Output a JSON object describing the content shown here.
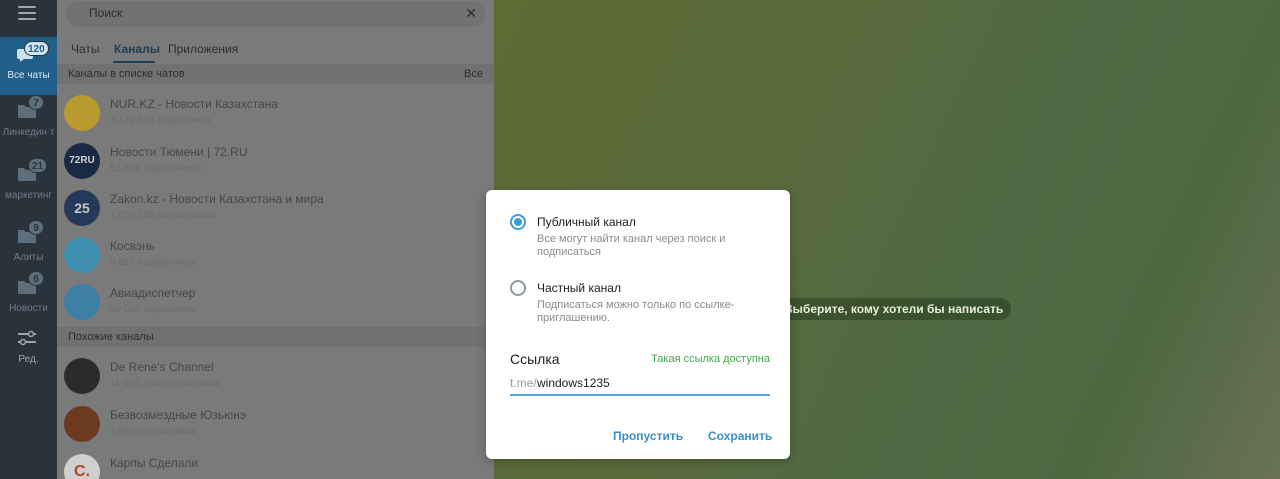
{
  "sidebar": {
    "folders": [
      {
        "label": "Все чаты",
        "badge": "120",
        "active": true
      },
      {
        "label": "Линкедин т",
        "badge": "7"
      },
      {
        "label": "маркетинг",
        "badge": "21"
      },
      {
        "label": "Алиты",
        "badge": "9"
      },
      {
        "label": "Новости",
        "badge": "6"
      },
      {
        "label": "Ред."
      }
    ]
  },
  "chatlist": {
    "search_placeholder": "Поиск",
    "tabs": [
      "Чаты",
      "Каналы",
      "Приложения"
    ],
    "section_in_list": "Каналы в списке чатов",
    "section_all": "Все",
    "channels": [
      {
        "name": "NUR.KZ - Новости Казахстана",
        "sub": "3 172 594 подписчика",
        "avatar_color": "#b89a2e",
        "avatar_text": ""
      },
      {
        "name": "Новости Тюмени | 72.RU",
        "sub": "53 536 подписчиков",
        "avatar_color": "#1b2a44",
        "avatar_text": "72RU"
      },
      {
        "name": "Zakon.kz - Новости Казахстана и мира",
        "sub": "1 036 228 подписчиков",
        "avatar_color": "#25395a",
        "avatar_text": "25"
      },
      {
        "name": "Косвэнь",
        "sub": "9 810 подписчиков",
        "avatar_color": "#3e8fb0",
        "avatar_text": ""
      },
      {
        "name": "Авиадиспетчер",
        "sub": "39 082 подписчика",
        "avatar_color": "#3e7fa6",
        "avatar_text": ""
      }
    ],
    "section_similar": "Похожие каналы",
    "similar": [
      {
        "name": "De Rene's Channel",
        "sub": "11 026 166 подписчиков",
        "avatar_color": "#2b2b2b",
        "avatar_text": ""
      },
      {
        "name": "Безвозмездные Юзьюнэ",
        "sub": "4 960 подписчиков",
        "avatar_color": "#6b3a1f",
        "avatar_text": ""
      },
      {
        "name": "Карпы Сделали",
        "sub": "",
        "avatar_color": "#eeeeee",
        "avatar_text": "C."
      }
    ]
  },
  "wallpaper": {
    "hint": "Выберите, кому хотели бы написать"
  },
  "modal": {
    "public_title": "Публичный канал",
    "public_desc": "Все могут найти канал через поиск и подписаться",
    "private_title": "Частный канал",
    "private_desc": "Подписаться можно только по ссылке-приглашению.",
    "link_label": "Ссылка",
    "link_status": "Такая ссылка доступна",
    "link_prefix": "t.me/",
    "link_value": "windows1235",
    "skip_label": "Пропустить",
    "save_label": "Сохранить"
  },
  "colors": {
    "accent": "#3a9be0",
    "success": "#44a74a",
    "rail": "#2a323b",
    "active_folder": "#1f5f8a"
  }
}
